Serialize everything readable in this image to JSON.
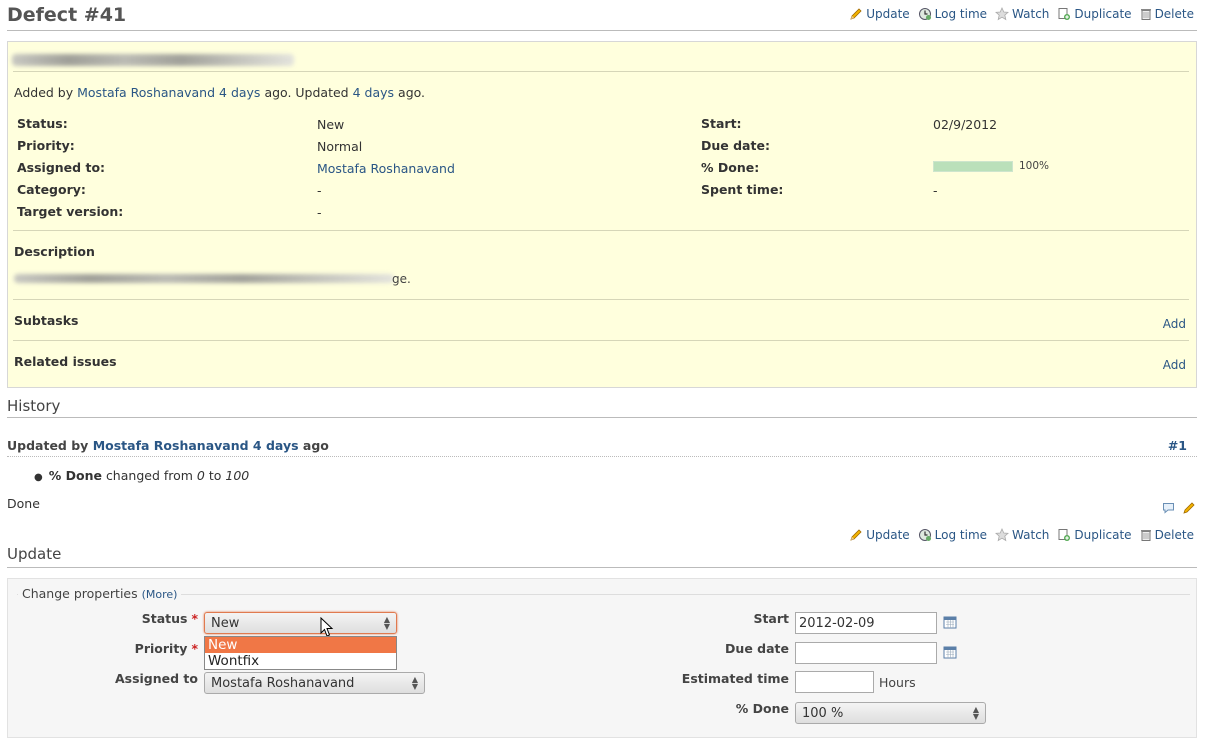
{
  "header": {
    "title": "Defect #41",
    "actions": {
      "update": "Update",
      "log_time": "Log time",
      "watch": "Watch",
      "duplicate": "Duplicate",
      "delete": "Delete"
    }
  },
  "issue": {
    "added_prefix": "Added by",
    "author": "Mostafa Roshanavand",
    "added_ago": "4 days",
    "updated_prefix": "ago. Updated",
    "updated_ago": "4 days",
    "updated_suffix": "ago.",
    "attributes_left": [
      {
        "label": "Status:",
        "value": "New",
        "link": false
      },
      {
        "label": "Priority:",
        "value": "Normal",
        "link": false
      },
      {
        "label": "Assigned to:",
        "value": "Mostafa Roshanavand",
        "link": true
      },
      {
        "label": "Category:",
        "value": "-",
        "link": false
      },
      {
        "label": "Target version:",
        "value": "-",
        "link": false
      }
    ],
    "attributes_right": [
      {
        "label": "Start:",
        "value": "02/9/2012"
      },
      {
        "label": "Due date:",
        "value": ""
      },
      {
        "label": "% Done:",
        "value": "100%"
      },
      {
        "label": "Spent time:",
        "value": "-"
      }
    ],
    "done_ratio": 1.0,
    "description_title": "Description",
    "description_tail": "ge.",
    "subtasks_title": "Subtasks",
    "related_title": "Related issues",
    "add_label": "Add"
  },
  "history": {
    "title": "History",
    "journal": {
      "prefix": "Updated by",
      "author": "Mostafa Roshanavand",
      "ago": "4 days",
      "suffix": "ago",
      "number": "#1",
      "change_field": "% Done",
      "change_text": "changed from",
      "from": "0",
      "to_word": "to",
      "to": "100",
      "note": "Done"
    }
  },
  "update_form": {
    "title": "Update",
    "legend": "Change properties",
    "more_link": "(More)",
    "required_mark": "*",
    "status_label": "Status",
    "status_value": "New",
    "status_options": [
      "New",
      "Wontfix"
    ],
    "priority_label": "Priority",
    "assigned_label": "Assigned to",
    "assigned_value": "Mostafa Roshanavand",
    "start_label": "Start",
    "start_value": "2012-02-09",
    "due_label": "Due date",
    "due_value": "",
    "estimated_label": "Estimated time",
    "estimated_value": "",
    "hours_label": "Hours",
    "done_label": "% Done",
    "done_value": "100 %"
  },
  "colors": {
    "link": "#2a5685",
    "issue_bg": "#ffffdd",
    "progress": "#bae0ba",
    "dropdown_highlight": "#f07746"
  }
}
